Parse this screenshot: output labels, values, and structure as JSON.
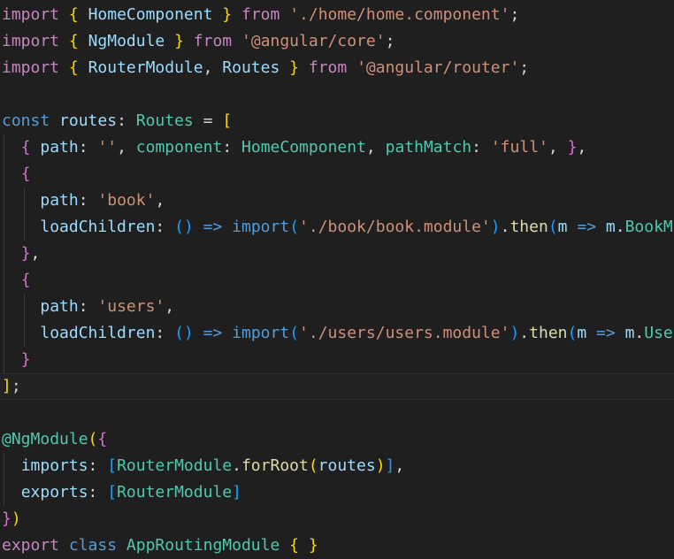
{
  "editor": {
    "language": "typescript",
    "theme": "dark-plus",
    "background_color": "#1f1f1f",
    "active_line_color": "#232323",
    "font_size_px": 18,
    "line_height_px": 30,
    "active_line_number": 12,
    "palette": {
      "keyword": "#c586c0",
      "control": "#569cd6",
      "variable": "#9cdcfe",
      "type": "#4ec9b0",
      "string": "#ce9178",
      "function": "#dcdcaa",
      "plain": "#d4d4d4",
      "bracket_yellow": "#ffd700",
      "bracket_magenta": "#da70d6",
      "bracket_blue": "#179fff",
      "indent_guide": "#404040"
    }
  },
  "code": {
    "plain_text": "import { HomeComponent } from './home/home.component';\nimport { NgModule } from '@angular/core';\nimport { RouterModule, Routes } from '@angular/router';\n\nconst routes: Routes = [\n  { path: '', component: HomeComponent, pathMatch: 'full', },\n  {\n    path: 'book',\n    loadChildren: () => import('./book/book.module').then(m => m.BookModule)\n  },\n  {\n    path: 'users',\n    loadChildren: () => import('./users/users.module').then(m => m.UsersModule)\n  }\n];\n\n@NgModule({\n  imports: [RouterModule.forRoot(routes)],\n  exports: [RouterModule]\n})\nexport class AppRoutingModule { }\n",
    "lines": [
      {
        "n": 1,
        "active": false,
        "guides": [],
        "tokens": [
          {
            "t": "import",
            "c": "t-kw"
          },
          {
            "t": " ",
            "c": "t-plain"
          },
          {
            "t": "{",
            "c": "t-br-y"
          },
          {
            "t": " ",
            "c": "t-plain"
          },
          {
            "t": "HomeComponent",
            "c": "t-var"
          },
          {
            "t": " ",
            "c": "t-plain"
          },
          {
            "t": "}",
            "c": "t-br-y"
          },
          {
            "t": " ",
            "c": "t-plain"
          },
          {
            "t": "from",
            "c": "t-kw"
          },
          {
            "t": " ",
            "c": "t-plain"
          },
          {
            "t": "'./home/home.component'",
            "c": "t-str"
          },
          {
            "t": ";",
            "c": "t-plain"
          }
        ]
      },
      {
        "n": 2,
        "active": false,
        "guides": [],
        "tokens": [
          {
            "t": "import",
            "c": "t-kw"
          },
          {
            "t": " ",
            "c": "t-plain"
          },
          {
            "t": "{",
            "c": "t-br-y"
          },
          {
            "t": " ",
            "c": "t-plain"
          },
          {
            "t": "NgModule",
            "c": "t-var"
          },
          {
            "t": " ",
            "c": "t-plain"
          },
          {
            "t": "}",
            "c": "t-br-y"
          },
          {
            "t": " ",
            "c": "t-plain"
          },
          {
            "t": "from",
            "c": "t-kw"
          },
          {
            "t": " ",
            "c": "t-plain"
          },
          {
            "t": "'@angular/core'",
            "c": "t-str"
          },
          {
            "t": ";",
            "c": "t-plain"
          }
        ]
      },
      {
        "n": 3,
        "active": false,
        "guides": [],
        "tokens": [
          {
            "t": "import",
            "c": "t-kw"
          },
          {
            "t": " ",
            "c": "t-plain"
          },
          {
            "t": "{",
            "c": "t-br-y"
          },
          {
            "t": " ",
            "c": "t-plain"
          },
          {
            "t": "RouterModule",
            "c": "t-var"
          },
          {
            "t": ",",
            "c": "t-plain"
          },
          {
            "t": " ",
            "c": "t-plain"
          },
          {
            "t": "Routes",
            "c": "t-var"
          },
          {
            "t": " ",
            "c": "t-plain"
          },
          {
            "t": "}",
            "c": "t-br-y"
          },
          {
            "t": " ",
            "c": "t-plain"
          },
          {
            "t": "from",
            "c": "t-kw"
          },
          {
            "t": " ",
            "c": "t-plain"
          },
          {
            "t": "'@angular/router'",
            "c": "t-str"
          },
          {
            "t": ";",
            "c": "t-plain"
          }
        ]
      },
      {
        "n": 4,
        "active": false,
        "guides": [],
        "tokens": []
      },
      {
        "n": 5,
        "active": false,
        "guides": [],
        "tokens": [
          {
            "t": "const",
            "c": "t-ctrl"
          },
          {
            "t": " ",
            "c": "t-plain"
          },
          {
            "t": "routes",
            "c": "t-var"
          },
          {
            "t": ":",
            "c": "t-plain"
          },
          {
            "t": " ",
            "c": "t-plain"
          },
          {
            "t": "Routes",
            "c": "t-type"
          },
          {
            "t": " ",
            "c": "t-plain"
          },
          {
            "t": "=",
            "c": "t-plain"
          },
          {
            "t": " ",
            "c": "t-plain"
          },
          {
            "t": "[",
            "c": "t-br-y"
          }
        ]
      },
      {
        "n": 6,
        "active": false,
        "guides": [
          "g1"
        ],
        "tokens": [
          {
            "t": "  ",
            "c": "t-plain"
          },
          {
            "t": "{",
            "c": "t-br-m"
          },
          {
            "t": " ",
            "c": "t-plain"
          },
          {
            "t": "path",
            "c": "t-var"
          },
          {
            "t": ":",
            "c": "t-plain"
          },
          {
            "t": " ",
            "c": "t-plain"
          },
          {
            "t": "''",
            "c": "t-str"
          },
          {
            "t": ",",
            "c": "t-plain"
          },
          {
            "t": " ",
            "c": "t-plain"
          },
          {
            "t": "component",
            "c": "t-type"
          },
          {
            "t": ":",
            "c": "t-plain"
          },
          {
            "t": " ",
            "c": "t-plain"
          },
          {
            "t": "HomeComponent",
            "c": "t-type"
          },
          {
            "t": ",",
            "c": "t-plain"
          },
          {
            "t": " ",
            "c": "t-plain"
          },
          {
            "t": "pathMatch",
            "c": "t-type"
          },
          {
            "t": ":",
            "c": "t-plain"
          },
          {
            "t": " ",
            "c": "t-plain"
          },
          {
            "t": "'full'",
            "c": "t-str"
          },
          {
            "t": ",",
            "c": "t-plain"
          },
          {
            "t": " ",
            "c": "t-plain"
          },
          {
            "t": "}",
            "c": "t-br-m"
          },
          {
            "t": ",",
            "c": "t-plain"
          }
        ]
      },
      {
        "n": 7,
        "active": false,
        "guides": [
          "g1"
        ],
        "tokens": [
          {
            "t": "  ",
            "c": "t-plain"
          },
          {
            "t": "{",
            "c": "t-br-m"
          }
        ]
      },
      {
        "n": 8,
        "active": false,
        "guides": [
          "g1",
          "g2"
        ],
        "tokens": [
          {
            "t": "    ",
            "c": "t-plain"
          },
          {
            "t": "path",
            "c": "t-var"
          },
          {
            "t": ":",
            "c": "t-plain"
          },
          {
            "t": " ",
            "c": "t-plain"
          },
          {
            "t": "'book'",
            "c": "t-str"
          },
          {
            "t": ",",
            "c": "t-plain"
          }
        ]
      },
      {
        "n": 9,
        "active": false,
        "guides": [
          "g1",
          "g2"
        ],
        "tokens": [
          {
            "t": "    ",
            "c": "t-plain"
          },
          {
            "t": "loadChildren",
            "c": "t-var"
          },
          {
            "t": ":",
            "c": "t-plain"
          },
          {
            "t": " ",
            "c": "t-plain"
          },
          {
            "t": "(",
            "c": "t-br-b"
          },
          {
            "t": ")",
            "c": "t-br-b"
          },
          {
            "t": " ",
            "c": "t-plain"
          },
          {
            "t": "=>",
            "c": "t-ctrl"
          },
          {
            "t": " ",
            "c": "t-plain"
          },
          {
            "t": "import",
            "c": "t-ctrl"
          },
          {
            "t": "(",
            "c": "t-br-b"
          },
          {
            "t": "'./book/book.module'",
            "c": "t-str"
          },
          {
            "t": ")",
            "c": "t-br-b"
          },
          {
            "t": ".",
            "c": "t-plain"
          },
          {
            "t": "then",
            "c": "t-fn"
          },
          {
            "t": "(",
            "c": "t-br-b"
          },
          {
            "t": "m",
            "c": "t-var"
          },
          {
            "t": " ",
            "c": "t-plain"
          },
          {
            "t": "=>",
            "c": "t-ctrl"
          },
          {
            "t": " ",
            "c": "t-plain"
          },
          {
            "t": "m",
            "c": "t-var"
          },
          {
            "t": ".",
            "c": "t-plain"
          },
          {
            "t": "BookModule",
            "c": "t-type"
          },
          {
            "t": ")",
            "c": "t-br-b"
          }
        ]
      },
      {
        "n": 10,
        "active": false,
        "guides": [
          "g1"
        ],
        "tokens": [
          {
            "t": "  ",
            "c": "t-plain"
          },
          {
            "t": "}",
            "c": "t-br-m"
          },
          {
            "t": ",",
            "c": "t-plain"
          }
        ]
      },
      {
        "n": 11,
        "active": false,
        "guides": [
          "g1"
        ],
        "tokens": [
          {
            "t": "  ",
            "c": "t-plain"
          },
          {
            "t": "{",
            "c": "t-br-m"
          }
        ]
      },
      {
        "n": 12,
        "active": false,
        "guides": [
          "g1",
          "g2"
        ],
        "tokens": [
          {
            "t": "    ",
            "c": "t-plain"
          },
          {
            "t": "path",
            "c": "t-var"
          },
          {
            "t": ":",
            "c": "t-plain"
          },
          {
            "t": " ",
            "c": "t-plain"
          },
          {
            "t": "'users'",
            "c": "t-str"
          },
          {
            "t": ",",
            "c": "t-plain"
          }
        ]
      },
      {
        "n": 13,
        "active": false,
        "guides": [
          "g1",
          "g2"
        ],
        "tokens": [
          {
            "t": "    ",
            "c": "t-plain"
          },
          {
            "t": "loadChildren",
            "c": "t-var"
          },
          {
            "t": ":",
            "c": "t-plain"
          },
          {
            "t": " ",
            "c": "t-plain"
          },
          {
            "t": "(",
            "c": "t-br-b"
          },
          {
            "t": ")",
            "c": "t-br-b"
          },
          {
            "t": " ",
            "c": "t-plain"
          },
          {
            "t": "=>",
            "c": "t-ctrl"
          },
          {
            "t": " ",
            "c": "t-plain"
          },
          {
            "t": "import",
            "c": "t-ctrl"
          },
          {
            "t": "(",
            "c": "t-br-b"
          },
          {
            "t": "'./users/users.module'",
            "c": "t-str"
          },
          {
            "t": ")",
            "c": "t-br-b"
          },
          {
            "t": ".",
            "c": "t-plain"
          },
          {
            "t": "then",
            "c": "t-fn"
          },
          {
            "t": "(",
            "c": "t-br-b"
          },
          {
            "t": "m",
            "c": "t-var"
          },
          {
            "t": " ",
            "c": "t-plain"
          },
          {
            "t": "=>",
            "c": "t-ctrl"
          },
          {
            "t": " ",
            "c": "t-plain"
          },
          {
            "t": "m",
            "c": "t-var"
          },
          {
            "t": ".",
            "c": "t-plain"
          },
          {
            "t": "UsersModule",
            "c": "t-type"
          },
          {
            "t": ")",
            "c": "t-br-b"
          }
        ]
      },
      {
        "n": 14,
        "active": false,
        "guides": [
          "g1"
        ],
        "tokens": [
          {
            "t": "  ",
            "c": "t-plain"
          },
          {
            "t": "}",
            "c": "t-br-m"
          }
        ]
      },
      {
        "n": 15,
        "active": true,
        "guides": [],
        "tokens": [
          {
            "t": "]",
            "c": "t-br-y"
          },
          {
            "t": ";",
            "c": "t-plain"
          }
        ]
      },
      {
        "n": 16,
        "active": false,
        "guides": [],
        "tokens": []
      },
      {
        "n": 17,
        "active": false,
        "guides": [],
        "tokens": [
          {
            "t": "@",
            "c": "t-type"
          },
          {
            "t": "NgModule",
            "c": "t-type"
          },
          {
            "t": "(",
            "c": "t-br-y"
          },
          {
            "t": "{",
            "c": "t-br-m"
          }
        ]
      },
      {
        "n": 18,
        "active": false,
        "guides": [
          "g1"
        ],
        "tokens": [
          {
            "t": "  ",
            "c": "t-plain"
          },
          {
            "t": "imports",
            "c": "t-var"
          },
          {
            "t": ":",
            "c": "t-plain"
          },
          {
            "t": " ",
            "c": "t-plain"
          },
          {
            "t": "[",
            "c": "t-br-b"
          },
          {
            "t": "RouterModule",
            "c": "t-type"
          },
          {
            "t": ".",
            "c": "t-plain"
          },
          {
            "t": "forRoot",
            "c": "t-fn"
          },
          {
            "t": "(",
            "c": "t-br-y"
          },
          {
            "t": "routes",
            "c": "t-var"
          },
          {
            "t": ")",
            "c": "t-br-y"
          },
          {
            "t": "]",
            "c": "t-br-b"
          },
          {
            "t": ",",
            "c": "t-plain"
          }
        ]
      },
      {
        "n": 19,
        "active": false,
        "guides": [
          "g1"
        ],
        "tokens": [
          {
            "t": "  ",
            "c": "t-plain"
          },
          {
            "t": "exports",
            "c": "t-var"
          },
          {
            "t": ":",
            "c": "t-plain"
          },
          {
            "t": " ",
            "c": "t-plain"
          },
          {
            "t": "[",
            "c": "t-br-b"
          },
          {
            "t": "RouterModule",
            "c": "t-type"
          },
          {
            "t": "]",
            "c": "t-br-b"
          }
        ]
      },
      {
        "n": 20,
        "active": false,
        "guides": [],
        "tokens": [
          {
            "t": "}",
            "c": "t-br-m"
          },
          {
            "t": ")",
            "c": "t-br-y"
          }
        ]
      },
      {
        "n": 21,
        "active": false,
        "guides": [],
        "tokens": [
          {
            "t": "export",
            "c": "t-kw"
          },
          {
            "t": " ",
            "c": "t-plain"
          },
          {
            "t": "class",
            "c": "t-ctrl"
          },
          {
            "t": " ",
            "c": "t-plain"
          },
          {
            "t": "AppRoutingModule",
            "c": "t-type"
          },
          {
            "t": " ",
            "c": "t-plain"
          },
          {
            "t": "{",
            "c": "t-br-y"
          },
          {
            "t": " ",
            "c": "t-plain"
          },
          {
            "t": "}",
            "c": "t-br-y"
          }
        ]
      }
    ]
  }
}
